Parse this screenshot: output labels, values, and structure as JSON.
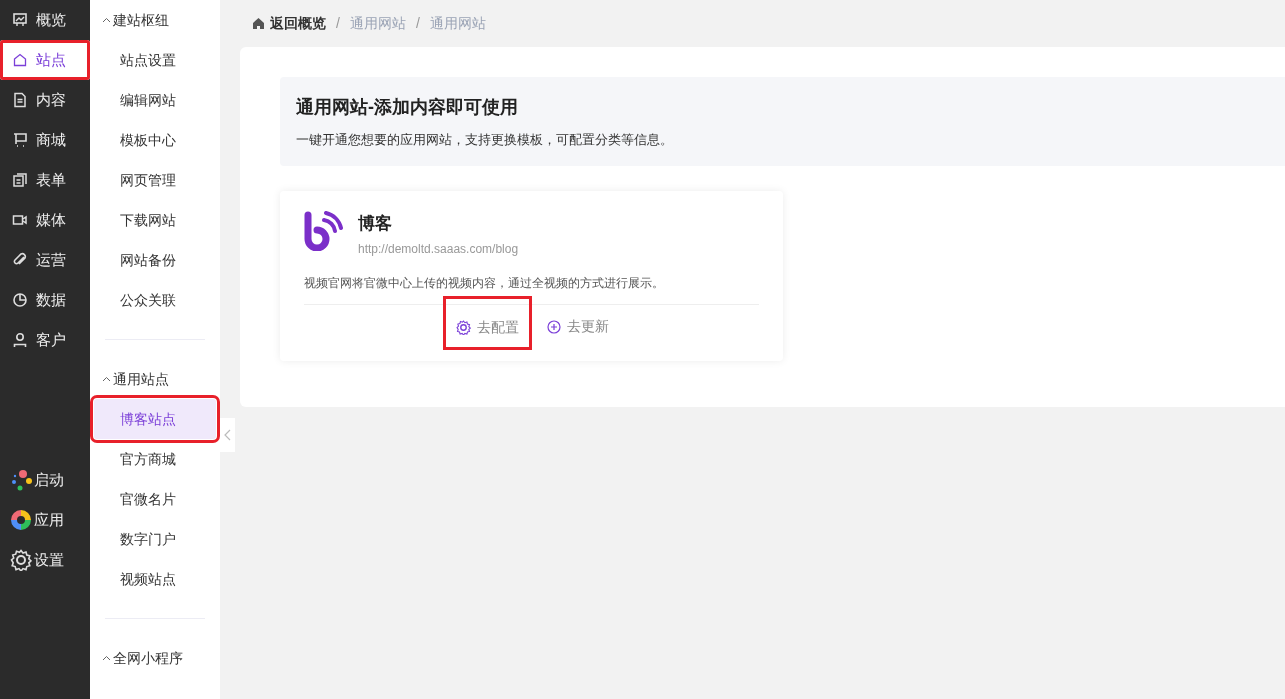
{
  "nav": {
    "items": [
      {
        "label": "概览",
        "selected": false,
        "highlighted": false
      },
      {
        "label": "站点",
        "selected": true,
        "highlighted": true
      },
      {
        "label": "内容",
        "selected": false,
        "highlighted": false
      },
      {
        "label": "商城",
        "selected": false,
        "highlighted": false
      },
      {
        "label": "表单",
        "selected": false,
        "highlighted": false
      },
      {
        "label": "媒体",
        "selected": false,
        "highlighted": false
      },
      {
        "label": "运营",
        "selected": false,
        "highlighted": false
      },
      {
        "label": "数据",
        "selected": false,
        "highlighted": false
      },
      {
        "label": "客户",
        "selected": false,
        "highlighted": false
      }
    ],
    "bottom_items": [
      {
        "label": "启动"
      },
      {
        "label": "应用"
      },
      {
        "label": "设置"
      }
    ]
  },
  "submenu": {
    "groups": [
      {
        "title": "建站枢纽",
        "expanded": true,
        "items": [
          {
            "label": "站点设置",
            "selected": false,
            "highlighted": false
          },
          {
            "label": "编辑网站",
            "selected": false,
            "highlighted": false
          },
          {
            "label": "模板中心",
            "selected": false,
            "highlighted": false
          },
          {
            "label": "网页管理",
            "selected": false,
            "highlighted": false
          },
          {
            "label": "下载网站",
            "selected": false,
            "highlighted": false
          },
          {
            "label": "网站备份",
            "selected": false,
            "highlighted": false
          },
          {
            "label": "公众关联",
            "selected": false,
            "highlighted": false
          }
        ]
      },
      {
        "title": "通用站点",
        "expanded": true,
        "items": [
          {
            "label": "博客站点",
            "selected": true,
            "highlighted": true
          },
          {
            "label": "官方商城",
            "selected": false,
            "highlighted": false
          },
          {
            "label": "官微名片",
            "selected": false,
            "highlighted": false
          },
          {
            "label": "数字门户",
            "selected": false,
            "highlighted": false
          },
          {
            "label": "视频站点",
            "selected": false,
            "highlighted": false
          }
        ]
      },
      {
        "title": "全网小程序",
        "expanded": true
      }
    ]
  },
  "breadcrumb": [
    {
      "label": "返回概览"
    },
    {
      "separator": "/",
      "label": "通用网站"
    },
    {
      "separator": "/",
      "label": "通用网站"
    }
  ],
  "banner": {
    "title": "通用网站-添加内容即可使用",
    "description": "一键开通您想要的应用网站，支持更换模板，可配置分类等信息。"
  },
  "cards": [
    {
      "title": "博客",
      "url": "http://demoltd.saaas.com/blog",
      "description": "视频官网将官微中心上传的视频内容，通过全视频的方式进行展示。",
      "actions": [
        {
          "label": "去配置",
          "kind": "configure",
          "highlighted": true
        },
        {
          "label": "去更新",
          "kind": "update",
          "highlighted": false
        }
      ]
    }
  ]
}
